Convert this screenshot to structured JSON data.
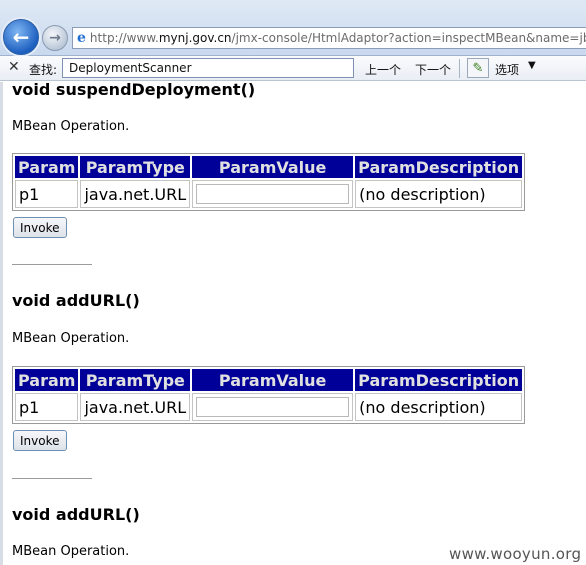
{
  "browser": {
    "address": {
      "prefix": "http://www.",
      "domain": "mynj.gov.cn",
      "path": "/jmx-console/HtmlAdaptor?action=inspectMBean&name=jbos"
    },
    "find_bar": {
      "label": "查找:",
      "value": "DeploymentScanner",
      "prev_label": "上一个",
      "next_label": "下一个",
      "options_label": "选项"
    }
  },
  "operations": [
    {
      "title": "void suspendDeployment()",
      "description": "MBean Operation.",
      "headers": [
        "Param",
        "ParamType",
        "ParamValue",
        "ParamDescription"
      ],
      "row": {
        "param": "p1",
        "type": "java.net.URL",
        "value": "",
        "description": "(no description)"
      },
      "invoke_label": "Invoke"
    },
    {
      "title": "void addURL()",
      "description": "MBean Operation.",
      "headers": [
        "Param",
        "ParamType",
        "ParamValue",
        "ParamDescription"
      ],
      "row": {
        "param": "p1",
        "type": "java.net.URL",
        "value": "",
        "description": "(no description)"
      },
      "invoke_label": "Invoke"
    },
    {
      "title": "void addURL()",
      "description": "MBean Operation."
    }
  ],
  "watermark": "www.wooyun.org",
  "colors": {
    "table_header_bg": "#000099",
    "table_header_text": "#e0e0e0"
  }
}
